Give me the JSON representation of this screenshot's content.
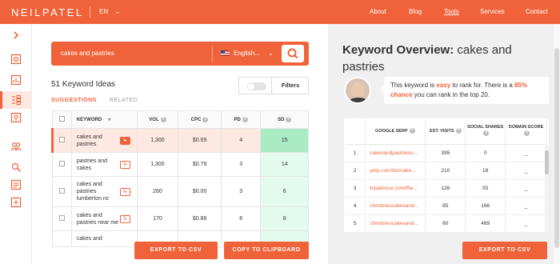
{
  "header": {
    "logo": "NEILPATEL",
    "language": "EN",
    "nav": [
      "About",
      "Blog",
      "Tools",
      "Services",
      "Contact"
    ],
    "active_nav": "Tools"
  },
  "sidebar": {
    "icons": [
      "chevron-right-icon",
      "site-audit-icon",
      "traffic-chart-icon",
      "keyword-ideas-icon",
      "location-icon",
      "users-icon",
      "search-analysis-icon",
      "content-ideas-icon",
      "backlinks-icon"
    ],
    "active": "keyword-ideas-icon"
  },
  "search": {
    "query": "cakes and pastries",
    "language": "English..."
  },
  "ideas": {
    "count_label": "51 Keyword Ideas",
    "filters_label": "Filters",
    "tab_suggestions": "SUGGESTIONS",
    "tab_related": "RELATED"
  },
  "keyword_table": {
    "headers": [
      "KEYWORD",
      "VOL",
      "CPC",
      "PD",
      "SD"
    ],
    "rows": [
      {
        "keyword": "cakes and pastries",
        "vol": "1,300",
        "cpc": "$0.69",
        "pd": "4",
        "sd": "15"
      },
      {
        "keyword": "pastries and cakes",
        "vol": "1,300",
        "cpc": "$0.79",
        "pd": "3",
        "sd": "14"
      },
      {
        "keyword": "cakes and pastries lumberton nc",
        "vol": "260",
        "cpc": "$0.00",
        "pd": "3",
        "sd": "6"
      },
      {
        "keyword": "cakes and pastries near me",
        "vol": "170",
        "cpc": "$0.88",
        "pd": "8",
        "sd": "8"
      },
      {
        "keyword": "cakes and",
        "vol": "",
        "cpc": "",
        "pd": "",
        "sd": ""
      }
    ]
  },
  "buttons": {
    "export_left": "EXPORT TO CSV",
    "copy_clipboard": "COPY TO CLIPBOARD",
    "export_right": "EXPORT TO CSV"
  },
  "overview": {
    "title_prefix": "Keyword Overview:",
    "title_keyword": "cakes and pastries",
    "msg_1": "This keyword is ",
    "msg_easy": "easy",
    "msg_2": " to rank for. There is a ",
    "msg_pct": "85% chance",
    "msg_3": " you can rank in the top 20."
  },
  "serp_table": {
    "headers": [
      "GOOGLE SERP",
      "EST. VISITS",
      "SOCIAL SHARES",
      "DOMAIN SCORE"
    ],
    "rows": [
      {
        "rank": "1",
        "url": "cakesandpastrieso...",
        "visits": "395",
        "shares": "0",
        "score": "_"
      },
      {
        "rank": "2",
        "url": "yelp.com/biz/cake...",
        "visits": "210",
        "shares": "18",
        "score": "_"
      },
      {
        "rank": "3",
        "url": "tripadvisor.com/Re...",
        "visits": "126",
        "shares": "55",
        "score": "_"
      },
      {
        "rank": "4",
        "url": "christinescakesand...",
        "visits": "85",
        "shares": "166",
        "score": "_"
      },
      {
        "rank": "5",
        "url": "christinescakesand...",
        "visits": "60",
        "shares": "489",
        "score": "_"
      }
    ]
  },
  "colors": {
    "accent": "#f0633a",
    "sd_easy": "#a9ecc4",
    "sd_very_easy": "#e3fbee"
  }
}
